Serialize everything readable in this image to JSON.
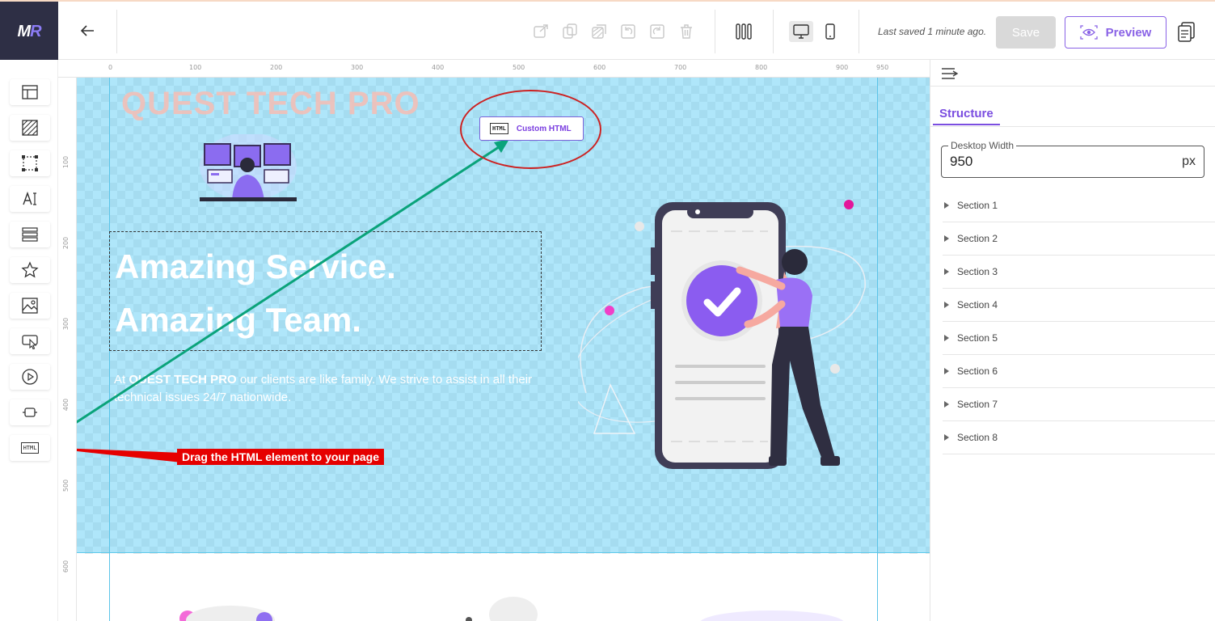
{
  "header": {
    "logo_text": "M",
    "logo_accent": "R",
    "last_saved": "Last saved 1 minute ago.",
    "save_label": "Save",
    "preview_label": "Preview"
  },
  "canvas": {
    "ruler_top": [
      "0",
      "100",
      "200",
      "300",
      "400",
      "500",
      "600",
      "700",
      "800",
      "900",
      "950"
    ],
    "ruler_left": [
      "100",
      "200",
      "300",
      "400",
      "500",
      "600"
    ],
    "brand": "QUEST TECH PRO",
    "headline_line1": "Amazing Service.",
    "headline_line2": "Amazing Team.",
    "para_prefix": "At ",
    "para_brand": "QUEST TECH PRO",
    "para_rest": " our clients are like family. We strive to assist in all their technical issues 24/7 nationwide.",
    "custom_html_badge": "HTML",
    "custom_html_label": "Custom HTML",
    "drag_instruction": "Drag the HTML element to your page"
  },
  "sidebar": {
    "html_badge": "HTML"
  },
  "panel": {
    "tab_structure": "Structure",
    "desktop_width_label": "Desktop Width",
    "desktop_width_value": "950",
    "desktop_width_unit": "px",
    "sections": [
      "Section 1",
      "Section 2",
      "Section 3",
      "Section 4",
      "Section 5",
      "Section 6",
      "Section 7",
      "Section 8"
    ]
  },
  "colors": {
    "accent": "#8a63e6",
    "logo_bg": "#2e2f45",
    "hero_overlay": "#6ed2f5",
    "annotation_red": "#e60000",
    "arrow_green": "#0aa37a"
  }
}
